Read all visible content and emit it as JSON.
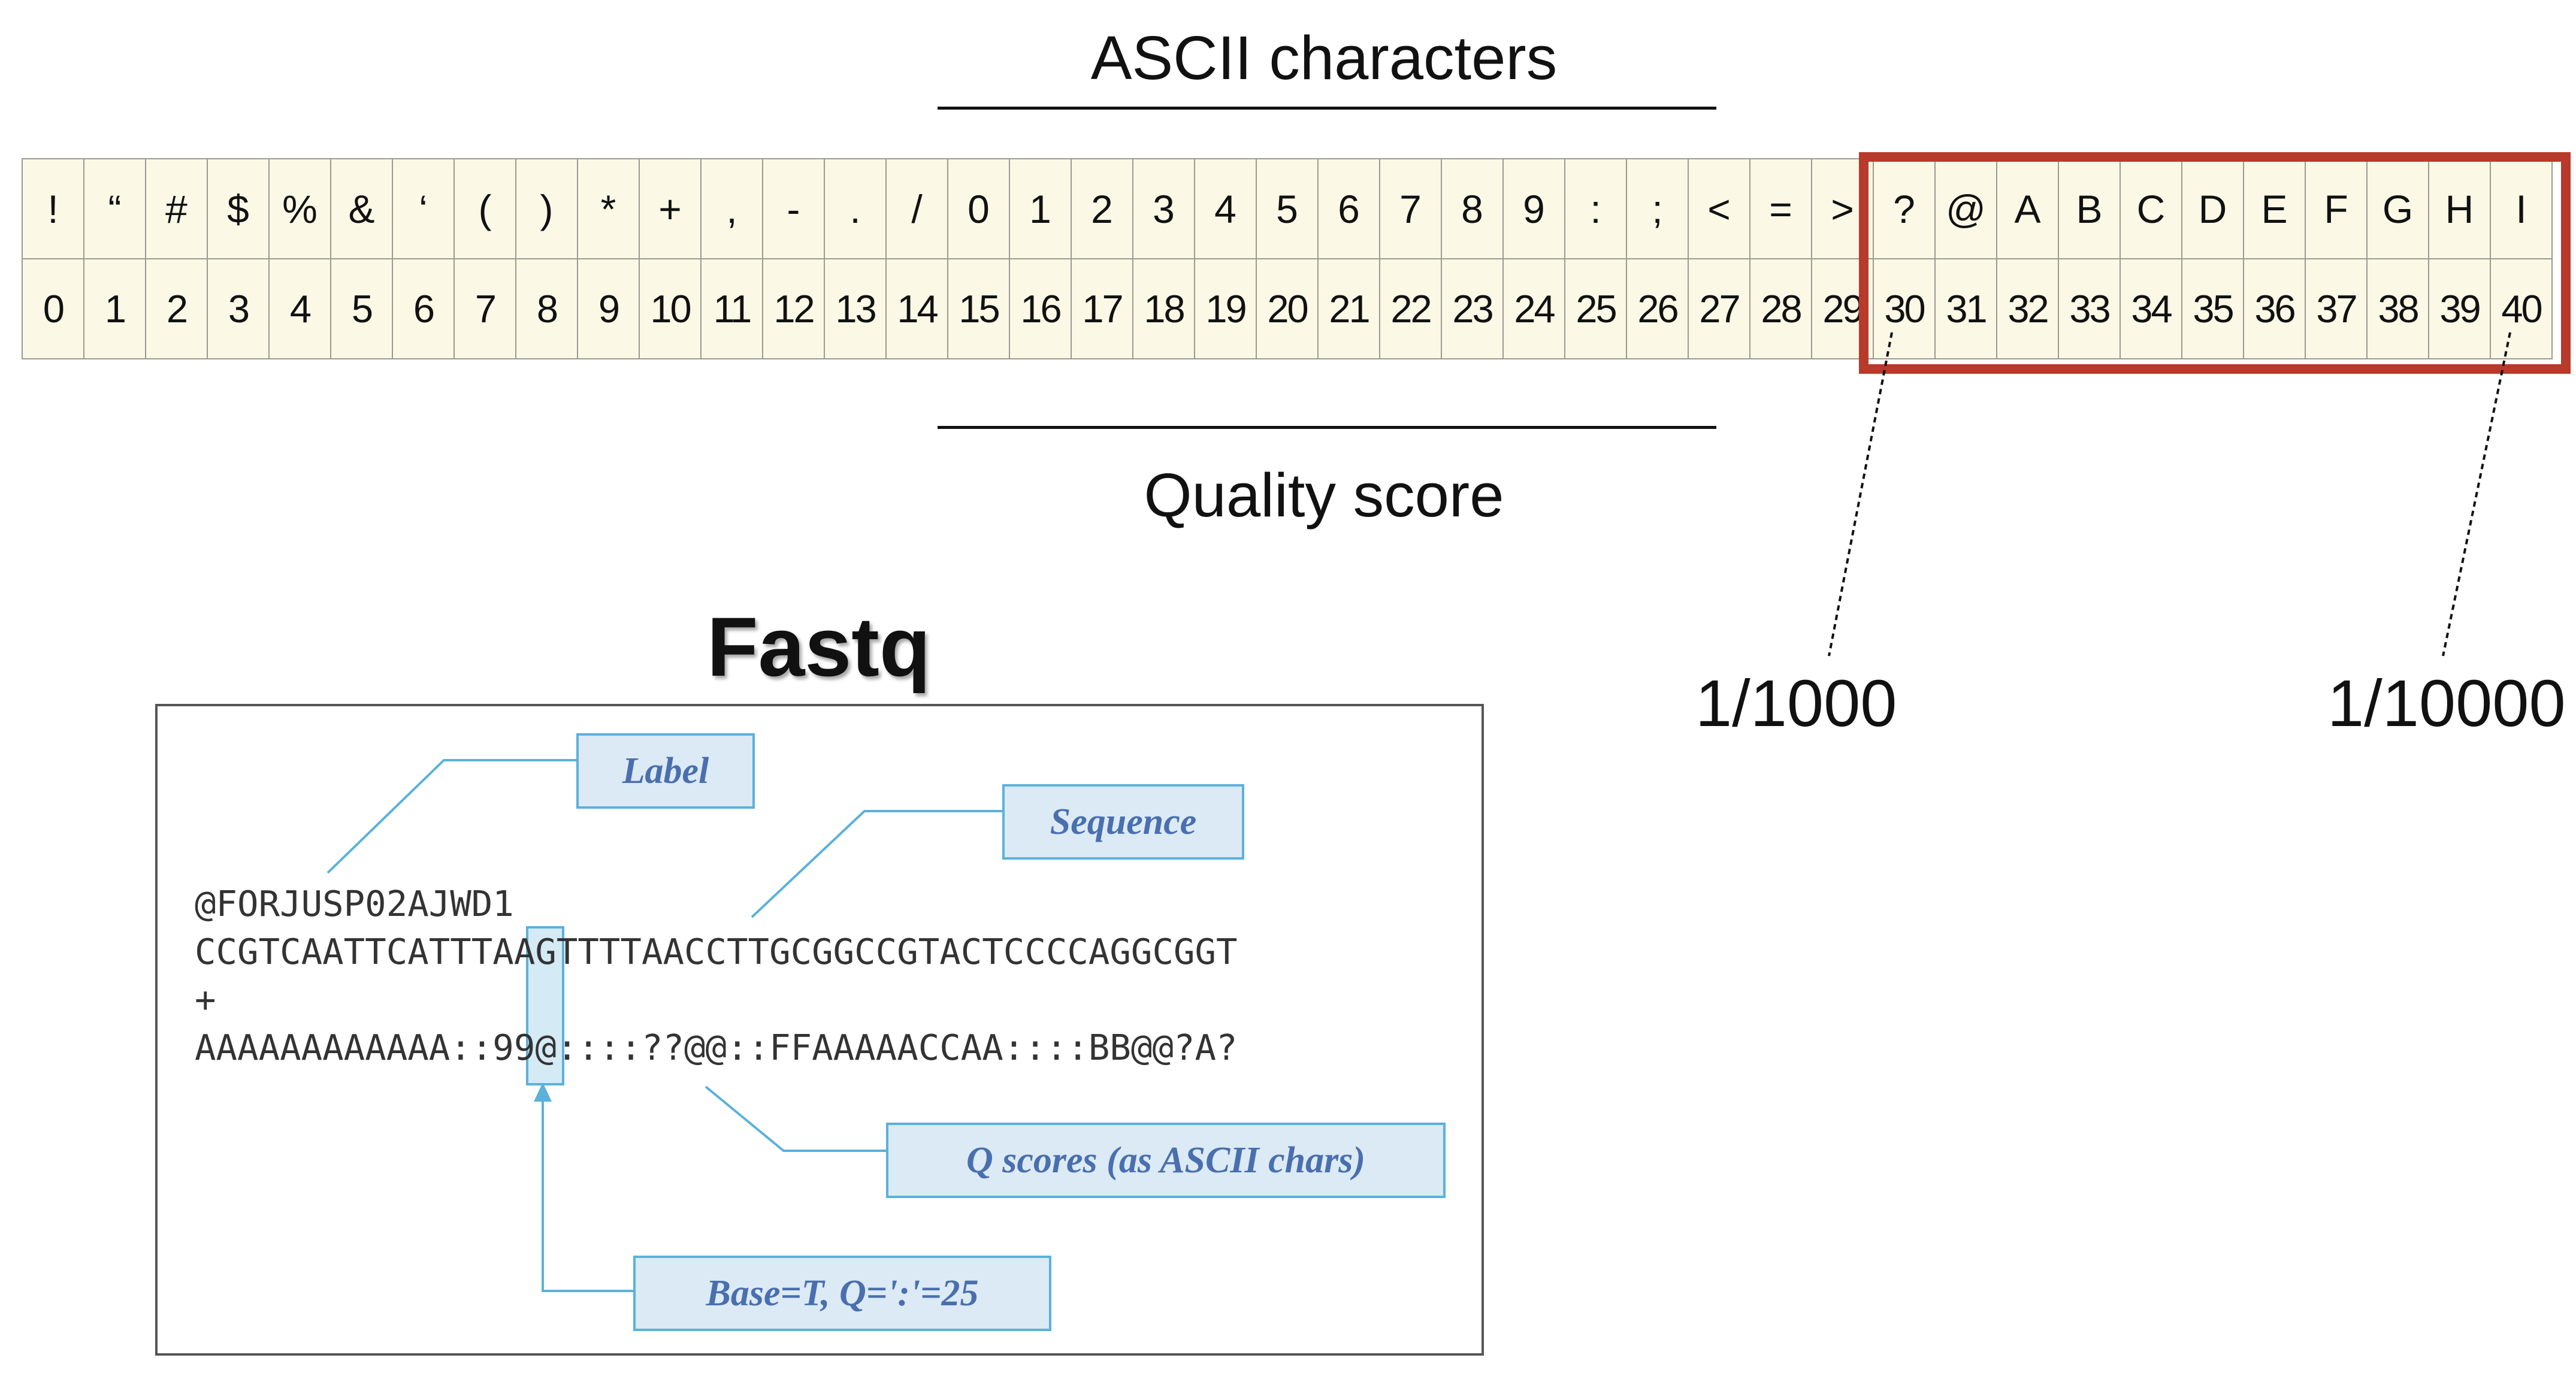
{
  "header": {
    "ascii_title": "ASCII characters",
    "quality_title": "Quality score"
  },
  "ascii_chars": [
    "!",
    "“",
    "#",
    "$",
    "%",
    "&",
    "‘",
    "(",
    ")",
    "*",
    "+",
    ",",
    "-",
    ".",
    "/",
    "0",
    "1",
    "2",
    "3",
    "4",
    "5",
    "6",
    "7",
    "8",
    "9",
    ":",
    ";",
    "<",
    "=",
    ">",
    "?",
    "@",
    "A",
    "B",
    "C",
    "D",
    "E",
    "F",
    "G",
    "H",
    "I"
  ],
  "quality_scores": [
    "0",
    "1",
    "2",
    "3",
    "4",
    "5",
    "6",
    "7",
    "8",
    "9",
    "10",
    "11",
    "12",
    "13",
    "14",
    "15",
    "16",
    "17",
    "18",
    "19",
    "20",
    "21",
    "22",
    "23",
    "24",
    "25",
    "26",
    "27",
    "28",
    "29",
    "30",
    "31",
    "32",
    "33",
    "34",
    "35",
    "36",
    "37",
    "38",
    "39",
    "40"
  ],
  "error_probabilities": {
    "at_30": "1/1000",
    "at_40": "1/10000"
  },
  "highlight_color": "#b83a2b",
  "fastq": {
    "title": "Fastq",
    "label_line": "@FORJUSP02AJWD1",
    "sequence_line": "CCGTCAATTCATTTAAGTTTTAACCTTGCGGCCGTACTCCCCAGGCGGT",
    "plus_line": "+",
    "quality_line": "AAAAAAAAAAAA::99@::::??@@::FFAAAAACCAA::::BB@@?A?",
    "callouts": {
      "label": "Label",
      "sequence": "Sequence",
      "q_scores": "Q scores (as ASCII chars)",
      "base_example": "Base=T, Q=':'=25"
    },
    "callout_color": "#5bb1db"
  }
}
